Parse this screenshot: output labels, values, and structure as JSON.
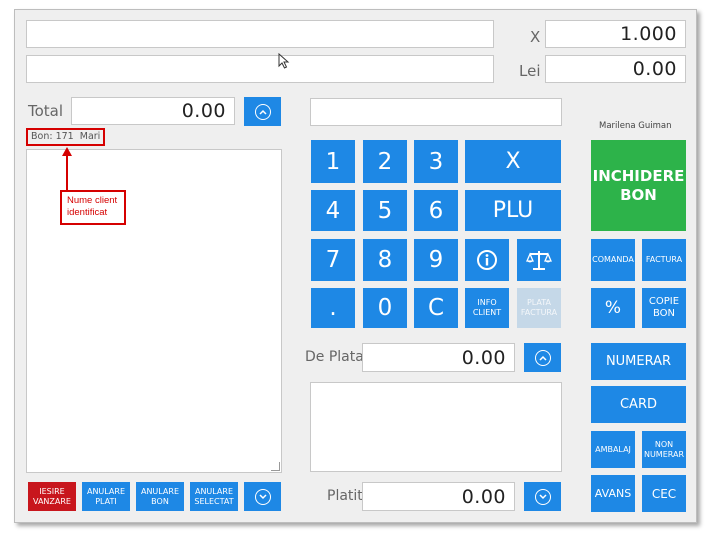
{
  "top": {
    "quantity_label": "X",
    "quantity_value": "1.000",
    "price_label": "Lei",
    "price_value": "0.00"
  },
  "receipt": {
    "total_label": "Total",
    "total_value": "0.00",
    "info": "Bon: 171  Mari"
  },
  "annotation": {
    "line1": "Nume client",
    "line2": "identificat"
  },
  "keypad": {
    "k1": "1",
    "k2": "2",
    "k3": "3",
    "kx": "X",
    "k4": "4",
    "k5": "5",
    "k6": "6",
    "kplu": "PLU",
    "k7": "7",
    "k8": "8",
    "k9": "9",
    "kdot": ".",
    "k0": "0",
    "kc": "C",
    "info_client": "INFO CLIENT",
    "plata_factura": "PLATA FACTURA"
  },
  "payment": {
    "de_plata_label": "De Plata",
    "de_plata_value": "0.00",
    "platit_label": "Platit",
    "platit_value": "0.00"
  },
  "right": {
    "operator": "Marilena Guiman",
    "inchidere": "INCHIDERE BON",
    "comanda": "COMANDA",
    "factura": "FACTURA",
    "percent": "%",
    "copie_bon": "COPIE BON",
    "numerar": "NUMERAR",
    "card": "CARD",
    "ambalaj": "AMBALAJ",
    "non_numerar": "NON NUMERAR",
    "avans": "AVANS",
    "cec": "CEC"
  },
  "bottom": {
    "iesire": "IESIRE VANZARE",
    "anulare_plati": "ANULARE PLATI",
    "anulare_bon": "ANULARE BON",
    "anulare_selectat": "ANULARE SELECTAT"
  },
  "colors": {
    "accent": "#1e88e5",
    "green": "#2db34a",
    "red": "#c8161d",
    "annotation": "#d50000"
  }
}
